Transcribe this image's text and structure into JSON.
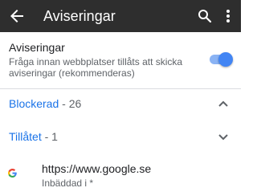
{
  "toolbar": {
    "title": "Aviseringar",
    "back_icon": "arrow-back-icon",
    "search_icon": "search-icon",
    "more_icon": "more-vertical-icon",
    "background": "#2e2e2e"
  },
  "notification_toggle": {
    "title": "Aviseringar",
    "summary": "Fråga innan webbplatser tillåts att skicka aviseringar (rekommenderas)",
    "enabled": true,
    "accent": "#4285f4"
  },
  "sections": {
    "blocked": {
      "label": "Blockerad",
      "count": " - 26",
      "expanded": true,
      "icon": "chevron-up-icon"
    },
    "allowed": {
      "label": "Tillåtet",
      "count": " - 1",
      "expanded": false,
      "icon": "chevron-down-icon"
    }
  },
  "sites": [
    {
      "url": "https://www.google.se",
      "subtitle": "Inbäddad i *",
      "icon": "google-favicon-icon"
    }
  ],
  "colors": {
    "link_blue": "#1a73e8",
    "primary_text": "#202124",
    "secondary_text": "#5f6368"
  }
}
